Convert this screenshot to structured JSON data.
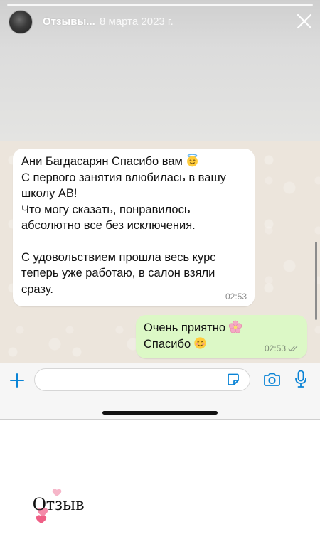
{
  "story": {
    "title": "Отзывы...",
    "date": "8 марта 2023 г.",
    "icons": {
      "avatar": "profile-avatar",
      "close": "close-icon"
    }
  },
  "chat": {
    "incoming": {
      "lines": [
        "Ани Багдасарян Спасибо вам",
        "С первого занятия влюбилась в вашу",
        "школу АВ!",
        "Что могу сказать, понравилось",
        "абсолютно все без исключения.",
        "С удовольствием прошла весь курс",
        "теперь уже работаю, в салон взяли",
        "сразу."
      ],
      "emoji": "smiling-face-with-halo-icon",
      "time": "02:53"
    },
    "outgoing": {
      "lines": [
        "Очень приятно",
        "Спасибо"
      ],
      "emojis": [
        "cherry-blossom-icon",
        "smiling-face-icon"
      ],
      "time": "02:53",
      "status": "double-check-icon"
    }
  },
  "input_bar": {
    "placeholder": "",
    "icons": [
      "plus-icon",
      "sticker-icon",
      "camera-icon",
      "mic-icon"
    ],
    "accent_color": "#0a84d6"
  },
  "sticker_label": {
    "text": "Отзыв",
    "decor": "hearts-icon"
  },
  "colors": {
    "bubble_incoming": "#ffffff",
    "bubble_outgoing": "#dcf8c6",
    "chat_bg": "#ece5dc"
  }
}
